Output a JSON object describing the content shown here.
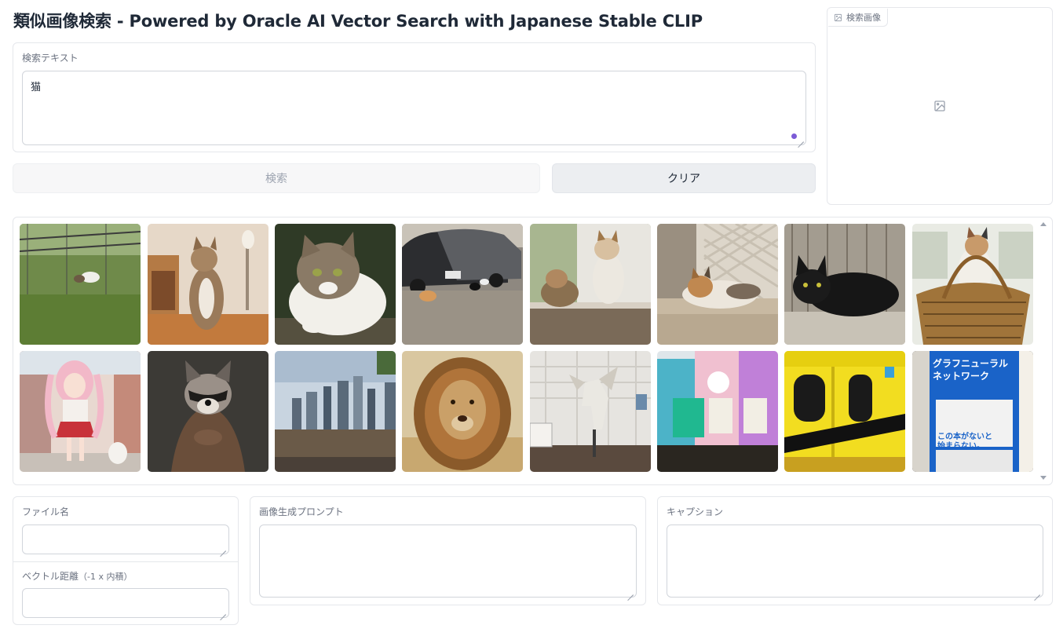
{
  "header": {
    "title": "類似画像検索 - Powered by Oracle AI Vector Search with Japanese Stable CLIP"
  },
  "search_text": {
    "label": "検索テキスト",
    "value": "猫"
  },
  "buttons": {
    "search": "検索",
    "clear": "クリア"
  },
  "search_image": {
    "label": "検索画像",
    "icon": "image-icon"
  },
  "gallery": {
    "items": [
      {
        "name": "gallery-image-cat-grass",
        "desc_icon": "image"
      },
      {
        "name": "gallery-image-cat-room"
      },
      {
        "name": "gallery-image-cat-closeup"
      },
      {
        "name": "gallery-image-cats-cars"
      },
      {
        "name": "gallery-image-kittens-window"
      },
      {
        "name": "gallery-image-cat-lattice"
      },
      {
        "name": "gallery-image-black-cat"
      },
      {
        "name": "gallery-image-kitten-basket"
      },
      {
        "name": "gallery-image-anime-girl-cat"
      },
      {
        "name": "gallery-image-raccoon"
      },
      {
        "name": "gallery-image-city-skyline"
      },
      {
        "name": "gallery-image-lion"
      },
      {
        "name": "gallery-image-robot-statue"
      },
      {
        "name": "gallery-image-manga-posters"
      },
      {
        "name": "gallery-image-yellow-train"
      },
      {
        "name": "gallery-image-book-cover"
      }
    ]
  },
  "fields": {
    "filename_label": "ファイル名",
    "filename_value": "",
    "distance_label": "ベクトル距離",
    "distance_suffix": "（-1 x 内積）",
    "distance_value": "",
    "prompt_label": "画像生成プロンプト",
    "prompt_value": "",
    "caption_label": "キャプション",
    "caption_value": ""
  },
  "book_cover": {
    "line1": "グラフニューラル",
    "line2": "ネットワーク",
    "line3": "この本がないと",
    "line4": "始まらない。"
  },
  "colors": {
    "accent": "#7c5bd6",
    "border": "#e5e7eb"
  }
}
